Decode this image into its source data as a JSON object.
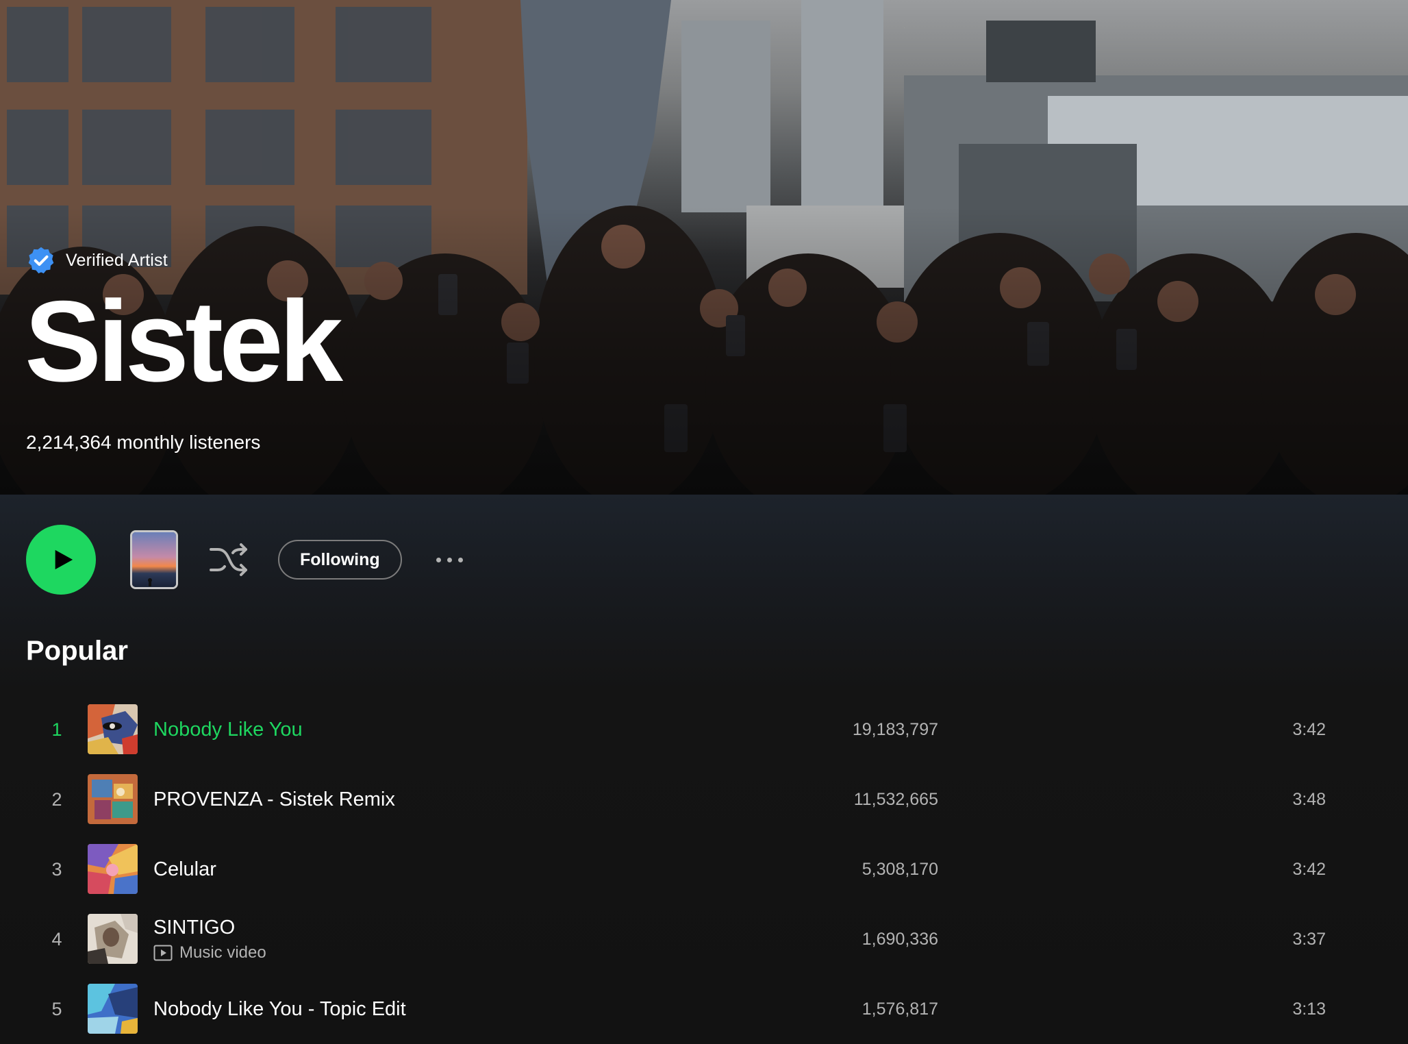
{
  "artist": {
    "verified_label": "Verified Artist",
    "name": "Sistek",
    "monthly_listeners": "2,214,364 monthly listeners"
  },
  "controls": {
    "play_icon": "play-icon",
    "shuffle_icon": "shuffle-icon",
    "following_label": "Following",
    "more_icon": "more-horizontal-icon"
  },
  "popular": {
    "title": "Popular",
    "tracks": [
      {
        "number": "1",
        "title": "Nobody Like You",
        "subtitle": "",
        "plays": "19,183,797",
        "duration": "3:42",
        "active": true
      },
      {
        "number": "2",
        "title": "PROVENZA - Sistek Remix",
        "subtitle": "",
        "plays": "11,532,665",
        "duration": "3:48",
        "active": false
      },
      {
        "number": "3",
        "title": "Celular",
        "subtitle": "",
        "plays": "5,308,170",
        "duration": "3:42",
        "active": false
      },
      {
        "number": "4",
        "title": "SINTIGO",
        "subtitle": "Music video",
        "plays": "1,690,336",
        "duration": "3:37",
        "active": false
      },
      {
        "number": "5",
        "title": "Nobody Like You - Topic Edit",
        "subtitle": "",
        "plays": "1,576,817",
        "duration": "3:13",
        "active": false
      }
    ]
  },
  "colors": {
    "accent": "#1ed760",
    "background": "#121212",
    "secondary_text": "#b3b3b3",
    "verified_badge": "#3d91f4"
  }
}
